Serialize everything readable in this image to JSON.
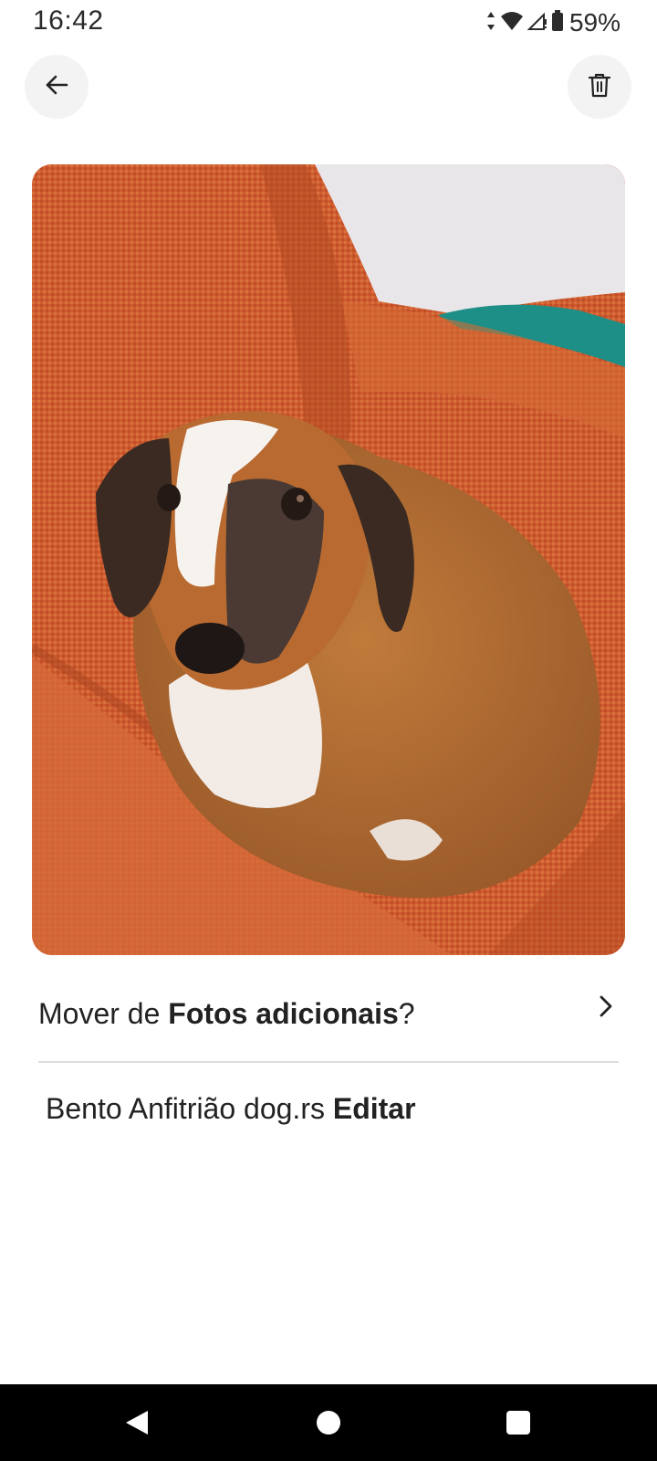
{
  "status_bar": {
    "time": "16:42",
    "battery_percent": "59%",
    "icons": [
      "data-arrows-icon",
      "wifi-icon",
      "signal-icon",
      "battery-icon"
    ]
  },
  "toolbar": {
    "back_icon": "arrow-left-icon",
    "delete_icon": "trash-icon"
  },
  "photo": {
    "subject": "dog-photo"
  },
  "move_row": {
    "prefix": "Mover de ",
    "album": "Fotos adicionais",
    "suffix": "?"
  },
  "caption": {
    "text": "Bento Anfitrião dog.rs",
    "edit_label": "Editar"
  },
  "nav_bar": {
    "icons": [
      "nav-back-icon",
      "nav-home-icon",
      "nav-recents-icon"
    ]
  },
  "colors": {
    "background": "#ffffff",
    "text": "#222222",
    "button_bg": "#f3f3f3",
    "divider": "#dddddd",
    "nav_bar": "#000000"
  }
}
